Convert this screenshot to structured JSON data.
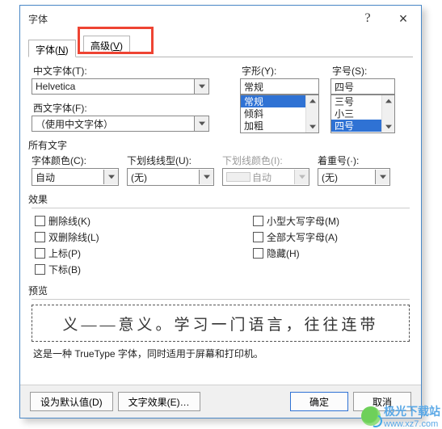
{
  "window": {
    "title": "字体",
    "help": "?",
    "close": "×"
  },
  "tabs": {
    "font": "字体(N)",
    "font_u": "N",
    "advanced": "高级(V)",
    "advanced_u": "V"
  },
  "cnfont": {
    "label": "中文字体(T):",
    "value": "Helvetica"
  },
  "westfont": {
    "label": "西文字体(F):",
    "value": "（使用中文字体）"
  },
  "style": {
    "label": "字形(Y):",
    "value": "常规",
    "items": [
      "常规",
      "倾斜",
      "加粗"
    ]
  },
  "size": {
    "label": "字号(S):",
    "value": "四号",
    "items": [
      "三号",
      "小三",
      "四号"
    ]
  },
  "alltext_header": "所有文字",
  "fontcolor": {
    "label": "字体颜色(C):",
    "value": "自动"
  },
  "ul_style": {
    "label": "下划线线型(U):",
    "value": "(无)"
  },
  "ul_color": {
    "label": "下划线颜色(I):",
    "value": "自动"
  },
  "emphasis": {
    "label": "着重号(·):",
    "value": "(无)"
  },
  "effects_header": "效果",
  "effects": {
    "strike": "删除线(K)",
    "dblstrike": "双删除线(L)",
    "sup": "上标(P)",
    "sub": "下标(B)",
    "smallcaps": "小型大写字母(M)",
    "allcaps": "全部大写字母(A)",
    "hidden": "隐藏(H)"
  },
  "preview_header": "预览",
  "preview_text": "义——意义。学习一门语言，往往连带",
  "preview_desc": "这是一种 TrueType 字体，同时适用于屏幕和打印机。",
  "buttons": {
    "default": "设为默认值(D)",
    "texteff": "文字效果(E)…",
    "ok": "确定",
    "cancel": "取消"
  },
  "watermark": {
    "text": "极光下载站",
    "url": "www.xz7.com"
  }
}
